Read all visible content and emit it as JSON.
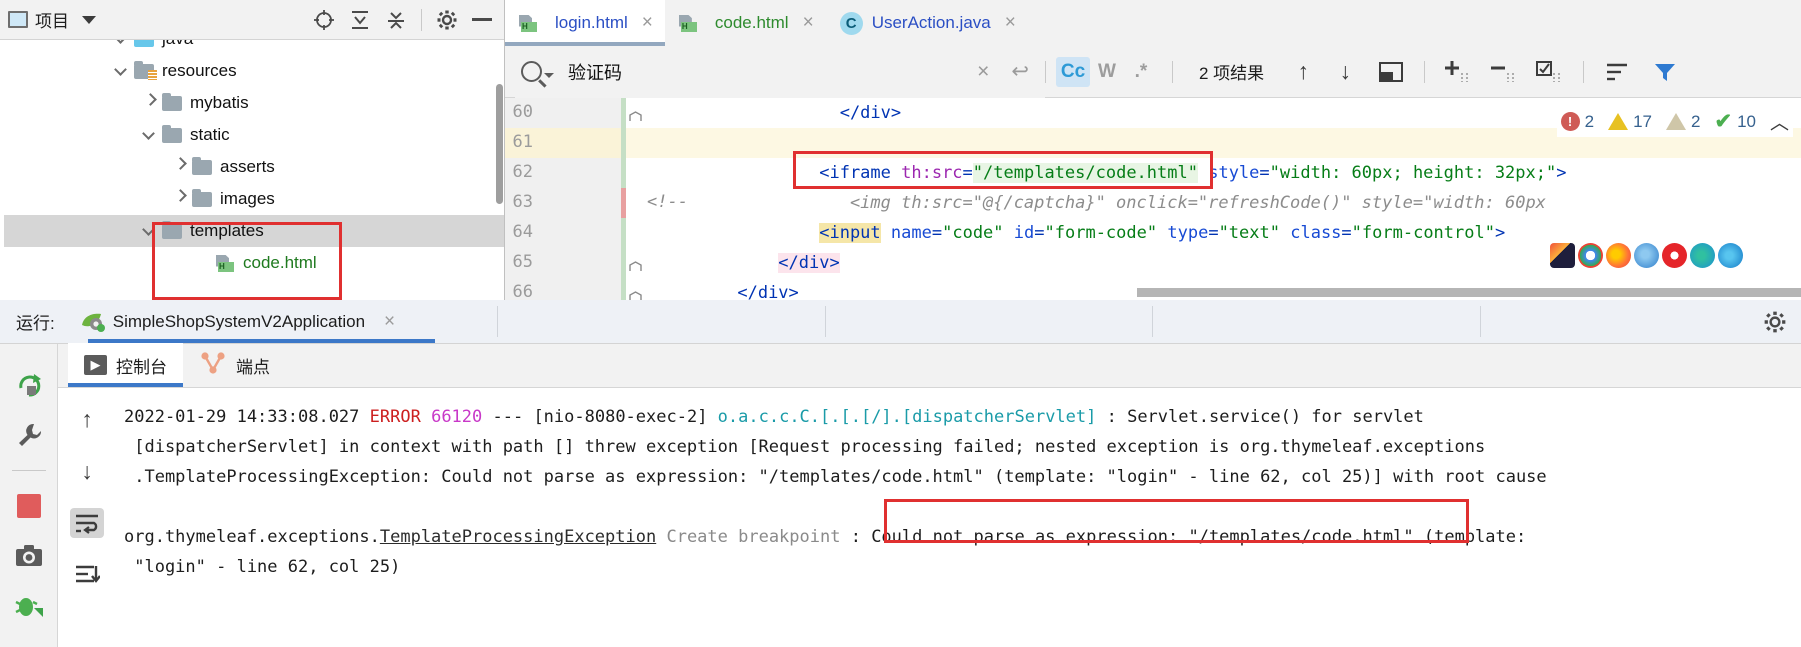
{
  "project_panel": {
    "title": "项目",
    "dropdown_icon": "chevron-down-icon",
    "toolbar_icons": [
      "locate-icon",
      "expand-all-icon",
      "collapse-all-icon",
      "gear-icon",
      "minimize-icon"
    ],
    "tree": [
      {
        "label": "java",
        "type": "folder-source",
        "indent": 2,
        "state": "expanded",
        "clipped": true
      },
      {
        "label": "resources",
        "type": "folder-resources",
        "indent": 2,
        "state": "expanded"
      },
      {
        "label": "mybatis",
        "type": "folder",
        "indent": 3,
        "state": "collapsed"
      },
      {
        "label": "static",
        "type": "folder",
        "indent": 3,
        "state": "expanded"
      },
      {
        "label": "asserts",
        "type": "folder",
        "indent": 4,
        "state": "collapsed"
      },
      {
        "label": "images",
        "type": "folder",
        "indent": 4,
        "state": "collapsed"
      },
      {
        "label": "templates",
        "type": "folder",
        "indent": 3,
        "state": "expanded",
        "selected": true
      },
      {
        "label": "code.html",
        "type": "html-file",
        "indent": 4,
        "state": "leaf"
      }
    ]
  },
  "editor": {
    "tabs": [
      {
        "label": "login.html",
        "icon": "html-file-icon",
        "active": true,
        "color": "#2b4fc4",
        "close": "×"
      },
      {
        "label": "code.html",
        "icon": "html-file-icon",
        "active": false,
        "color": "#2e8b2e",
        "close": "×"
      },
      {
        "label": "UserAction.java",
        "icon": "java-class-icon",
        "active": false,
        "color": "#2b4fc4",
        "close": "×"
      }
    ],
    "find": {
      "icon": "search-icon",
      "query": "验证码",
      "clear_icon": "×",
      "history_icon": "↩",
      "options": [
        {
          "label": "Cc",
          "name": "match-case-toggle",
          "active": true
        },
        {
          "label": "W",
          "name": "whole-words-toggle",
          "active": false
        },
        {
          "label": ".*",
          "name": "regex-toggle",
          "active": false
        }
      ],
      "result_count": "2 项结果",
      "prev_icon": "↑",
      "next_icon": "↓",
      "select_all_icon": "select-occurrences-icon",
      "toolbar_icons": [
        "add-selection-icon",
        "remove-selection-icon",
        "select-all-occurrences-icon",
        "filter-list-icon",
        "filter-icon"
      ]
    },
    "lines": [
      {
        "num": "60",
        "fold": true,
        "current": false,
        "segments": [
          {
            "t": "                    ",
            "c": "plain"
          },
          {
            "t": "</div>",
            "c": "tag"
          }
        ]
      },
      {
        "num": "61",
        "fold": false,
        "current": true,
        "segments": [
          {
            "t": "",
            "c": "plain"
          }
        ]
      },
      {
        "num": "62",
        "fold": false,
        "current": false,
        "highlighted": true,
        "segments": [
          {
            "t": "                ",
            "c": "plain"
          },
          {
            "t": "<iframe ",
            "c": "tag"
          },
          {
            "t": "th:src",
            "c": "attrname-th"
          },
          {
            "t": "=",
            "c": "plain"
          },
          {
            "t": "\"/templates/code.html\"",
            "c": "val-hl"
          },
          {
            "t": " ",
            "c": "plain"
          },
          {
            "t": "style",
            "c": "attr"
          },
          {
            "t": "=",
            "c": "plain"
          },
          {
            "t": "\"width: 60px; height: 32px;\"",
            "c": "val"
          },
          {
            "t": ">",
            "c": "tag"
          }
        ]
      },
      {
        "num": "63",
        "fold": false,
        "current": false,
        "comment_marker": "<!--",
        "segments": [
          {
            "t": "                    <img th:src=\"@{/captcha}\" onclick=\"refreshCode()\" style=\"width: 60px",
            "c": "comment"
          }
        ]
      },
      {
        "num": "64",
        "fold": false,
        "current": false,
        "segments": [
          {
            "t": "                ",
            "c": "plain"
          },
          {
            "t": "<input",
            "c": "tag-hl"
          },
          {
            "t": " ",
            "c": "plain"
          },
          {
            "t": "name",
            "c": "attr"
          },
          {
            "t": "=",
            "c": "plain"
          },
          {
            "t": "\"code\"",
            "c": "val"
          },
          {
            "t": " ",
            "c": "plain"
          },
          {
            "t": "id",
            "c": "attr"
          },
          {
            "t": "=",
            "c": "plain"
          },
          {
            "t": "\"form-code\"",
            "c": "val"
          },
          {
            "t": " ",
            "c": "plain"
          },
          {
            "t": "type",
            "c": "attr"
          },
          {
            "t": "=",
            "c": "plain"
          },
          {
            "t": "\"text\"",
            "c": "val"
          },
          {
            "t": " ",
            "c": "plain"
          },
          {
            "t": "class",
            "c": "attr"
          },
          {
            "t": "=",
            "c": "plain"
          },
          {
            "t": "\"form-control\"",
            "c": "val"
          },
          {
            "t": ">",
            "c": "tag"
          }
        ]
      },
      {
        "num": "65",
        "fold": true,
        "current": false,
        "segments": [
          {
            "t": "            ",
            "c": "plain"
          },
          {
            "t": "</div>",
            "c": "tag-pink"
          }
        ]
      },
      {
        "num": "66",
        "fold": true,
        "current": false,
        "segments": [
          {
            "t": "        ",
            "c": "plain"
          },
          {
            "t": "</div>",
            "c": "tag"
          }
        ]
      }
    ],
    "inspections": [
      {
        "name": "error-count",
        "icon": "error-icon",
        "value": "2",
        "color": "#cf5b56"
      },
      {
        "name": "warning-count",
        "icon": "warning-icon",
        "value": "17",
        "color": "#e7c122"
      },
      {
        "name": "weak-warning-count",
        "icon": "weak-warning-icon",
        "value": "2",
        "color": "#cfc6a8"
      },
      {
        "name": "ok-count",
        "icon": "check-icon",
        "value": "10",
        "color": "#4caf50"
      }
    ],
    "inspection_collapse_icon": "chevron-up-icon"
  },
  "run_window": {
    "label": "运行:",
    "configuration": "SimpleShopSystemV2Application",
    "config_icon": "spring-boot-icon",
    "close_icon": "×",
    "settings_icon": "gear-icon",
    "tabs": [
      {
        "label": "控制台",
        "icon": "console-icon",
        "active": true
      },
      {
        "label": "端点",
        "icon": "endpoints-icon",
        "active": false
      }
    ],
    "left_tools": [
      "rerun-icon",
      "wrench-icon",
      "stop-icon",
      "camera-icon",
      "debug-icon"
    ],
    "console_tools": [
      "scroll-up-icon",
      "scroll-down-icon",
      "soft-wrap-icon",
      "scroll-to-end-icon"
    ],
    "console": {
      "lines": [
        {
          "name": "log-line-error-1",
          "parts": [
            {
              "t": "2022-01-29 14:33:08.027 ",
              "c": "plain"
            },
            {
              "t": "ERROR",
              "c": "err"
            },
            {
              "t": " ",
              "c": "plain"
            },
            {
              "t": "66120",
              "c": "pid"
            },
            {
              "t": " --- [nio-8080-exec-2] ",
              "c": "plain"
            },
            {
              "t": "o.a.c.c.C.[.[.[/].[dispatcherServlet]",
              "c": "cls"
            },
            {
              "t": "   : Servlet.service() for servlet",
              "c": "plain"
            }
          ]
        },
        {
          "name": "log-line-error-2",
          "parts": [
            {
              "t": " [dispatcherServlet] in context with path [] threw exception [Request processing failed; nested exception is org.thymeleaf.exceptions",
              "c": "plain"
            }
          ]
        },
        {
          "name": "log-line-error-3",
          "parts": [
            {
              "t": " .TemplateProcessingException: Could not parse as expression: \"/templates/code.html\" (template: \"login\" - line 62, col 25)] with root cause",
              "c": "plain"
            }
          ]
        },
        {
          "name": "log-line-blank",
          "parts": [
            {
              "t": "",
              "c": "plain"
            }
          ]
        },
        {
          "name": "log-line-exception",
          "parts": [
            {
              "t": "org.thymeleaf.exceptions.",
              "c": "plain"
            },
            {
              "t": "TemplateProcessingException",
              "c": "link"
            },
            {
              "t": " ",
              "c": "plain"
            },
            {
              "t": "Create breakpoint",
              "c": "bp"
            },
            {
              "t": " : ",
              "c": "plain"
            },
            {
              "t": "Could not parse as expression: \"/templates/code.html\"",
              "c": "boxed"
            },
            {
              "t": " (template:",
              "c": "plain"
            }
          ]
        },
        {
          "name": "log-line-exception-cont",
          "parts": [
            {
              "t": " \"login\" - line 62, col 25)",
              "c": "plain"
            }
          ]
        }
      ]
    }
  },
  "annotations": {
    "highlight_color": "#e03030",
    "boxes": [
      "templates-folder-highlight",
      "iframe-line-highlight",
      "error-message-highlight"
    ]
  }
}
